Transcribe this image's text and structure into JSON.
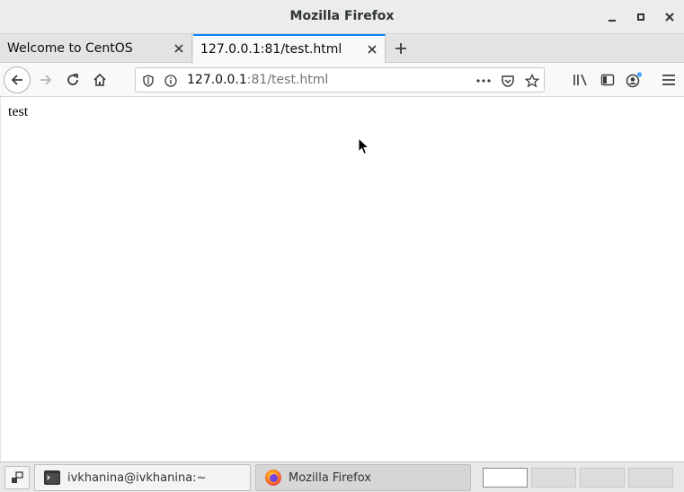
{
  "window": {
    "title": "Mozilla Firefox"
  },
  "tabs": [
    {
      "label": "Welcome to CentOS",
      "active": false
    },
    {
      "label": "127.0.0.1:81/test.html",
      "active": true
    }
  ],
  "urlbar": {
    "host": "127.0.0.1",
    "rest": ":81/test.html"
  },
  "page": {
    "text": "test"
  },
  "taskbar": {
    "items": [
      {
        "label": "ivkhanina@ivkhanina:~",
        "icon": "terminal-icon"
      },
      {
        "label": "Mozilla Firefox",
        "icon": "firefox-icon"
      }
    ],
    "workspaces": 4,
    "active_workspace": 1
  },
  "colors": {
    "tab_accent": "#0a84ff",
    "account_dot": "#45a1ff"
  }
}
